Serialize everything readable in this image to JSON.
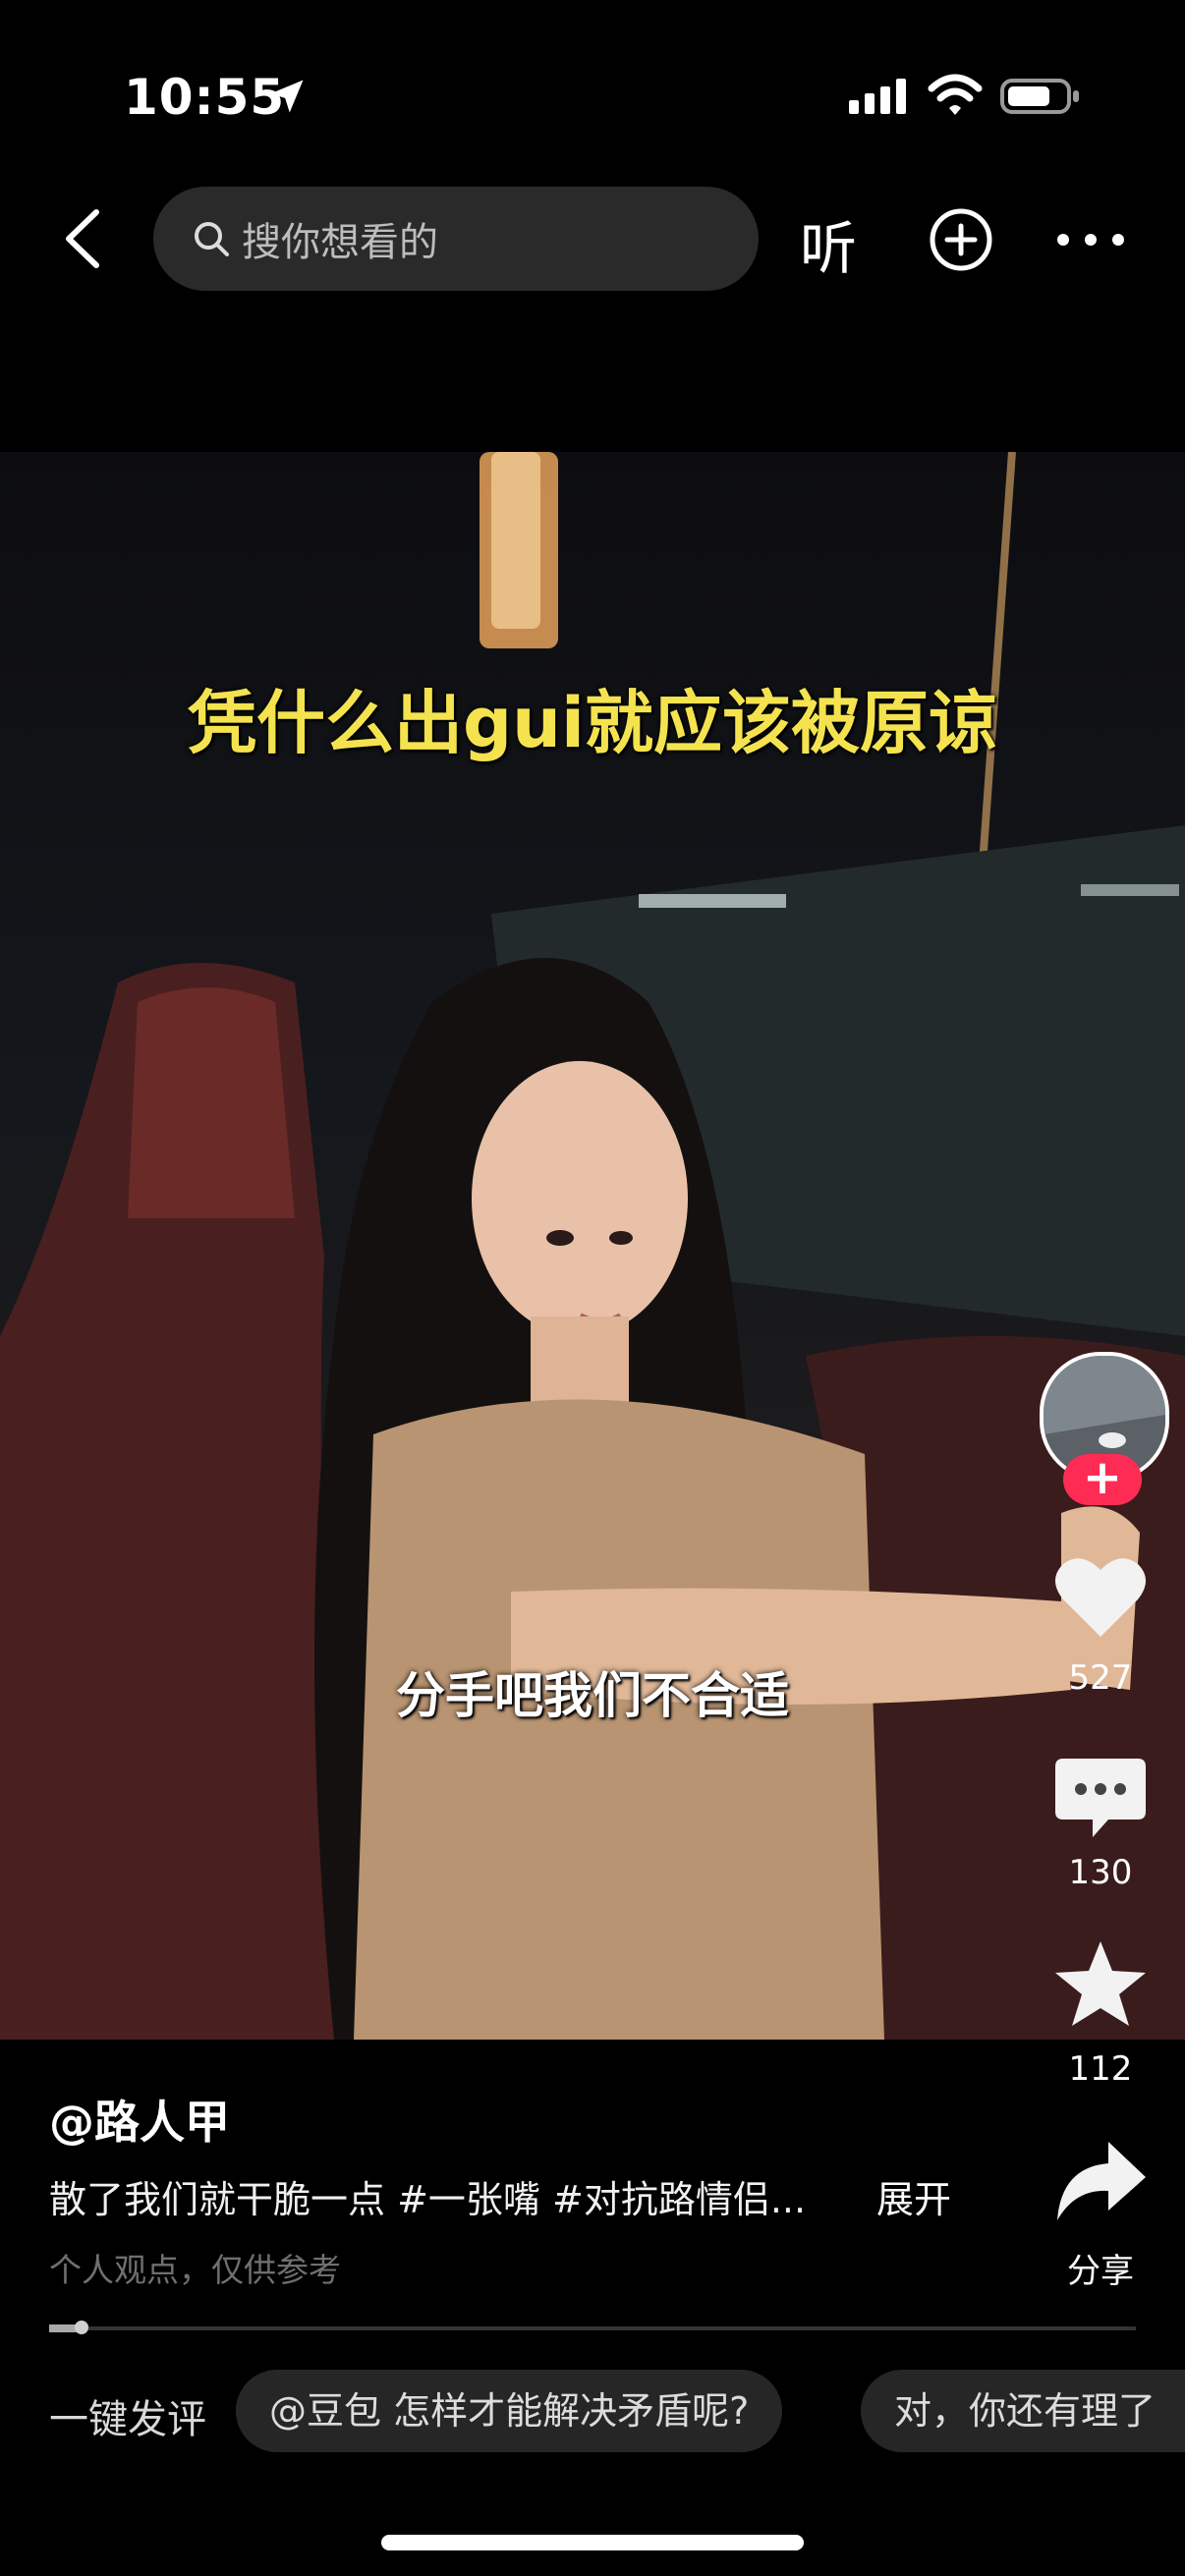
{
  "status_bar": {
    "time": "10:55"
  },
  "top_nav": {
    "search_placeholder": "搜你想看的",
    "listen_label": "听"
  },
  "video": {
    "caption_top": "凭什么出gui就应该被原谅",
    "caption_subtitle": "分手吧我们不合适"
  },
  "right_rail": {
    "follow_label": "+",
    "like_count": "527",
    "comment_count": "130",
    "favorite_count": "112",
    "share_label": "分享"
  },
  "post": {
    "author": "@路人甲",
    "description": "散了我们就干脆一点 #一张嘴 #对抗路情侣...",
    "expand_label": "展开",
    "disclaimer": "个人观点，仅供参考",
    "progress_fraction": 0.03
  },
  "quick_comment": {
    "label": "一键发评",
    "chips": [
      "@豆包 怎样才能解决矛盾呢?",
      "对，你还有理了"
    ]
  },
  "colors": {
    "caption_yellow": "#f4e34f",
    "follow_red": "#fe2c55",
    "background": "#000000"
  }
}
